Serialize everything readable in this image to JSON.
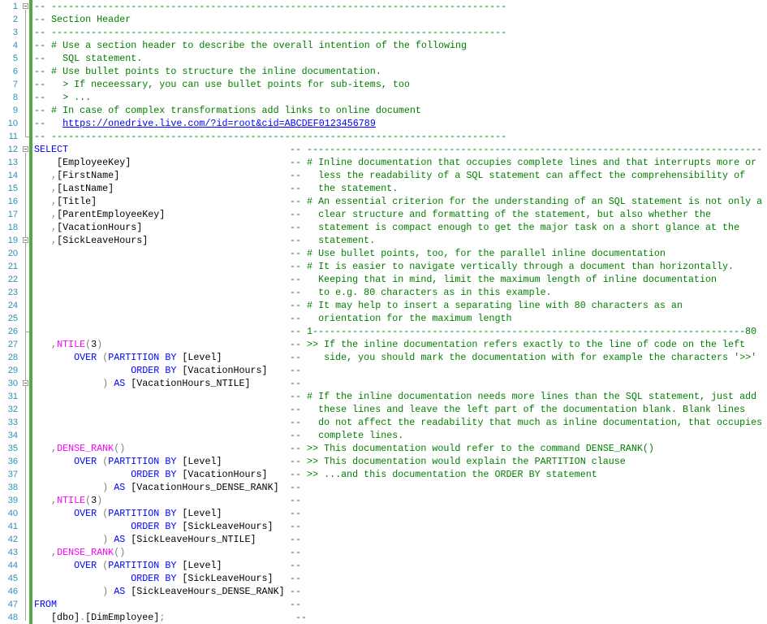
{
  "editor": {
    "colors": {
      "keyword": "#0000ff",
      "function": "#ff00ff",
      "punctuation": "#808080",
      "comment": "#008000",
      "line_number": "#2b91af",
      "change_bar": "#57a64a"
    },
    "lines": [
      {
        "num": "1",
        "code": [
          [
            "c",
            "-- --------------------------------------------------------------------------------"
          ]
        ],
        "comment": ""
      },
      {
        "num": "2",
        "code": [
          [
            "c",
            "-- Section Header"
          ]
        ],
        "comment": ""
      },
      {
        "num": "3",
        "code": [
          [
            "c",
            "-- --------------------------------------------------------------------------------"
          ]
        ],
        "comment": ""
      },
      {
        "num": "4",
        "code": [
          [
            "c",
            "-- # Use a section header to describe the overall intention of the following"
          ]
        ],
        "comment": ""
      },
      {
        "num": "5",
        "code": [
          [
            "c",
            "--   SQL statement."
          ]
        ],
        "comment": ""
      },
      {
        "num": "6",
        "code": [
          [
            "c",
            "-- # Use bullet points to structure the inline documentation."
          ]
        ],
        "comment": ""
      },
      {
        "num": "7",
        "code": [
          [
            "c",
            "--   > If neceessary, you can use bullet points for sub-items, too"
          ]
        ],
        "comment": ""
      },
      {
        "num": "8",
        "code": [
          [
            "c",
            "--   > ..."
          ]
        ],
        "comment": ""
      },
      {
        "num": "9",
        "code": [
          [
            "c",
            "-- # In case of complex transformations add links to online document"
          ]
        ],
        "comment": ""
      },
      {
        "num": "10",
        "code": [
          [
            "c",
            "--   "
          ],
          [
            "u",
            "https://onedrive.live.com/?id=root&cid=ABCDEF0123456789"
          ]
        ],
        "comment": ""
      },
      {
        "num": "11",
        "code": [
          [
            "c",
            "-- --------------------------------------------------------------------------------"
          ]
        ],
        "comment": ""
      },
      {
        "num": "12",
        "code": [
          [
            "k",
            "SELECT"
          ]
        ],
        "comment": "-- --------------------------------------------------------------------------------"
      },
      {
        "num": "13",
        "code": [
          [
            "n",
            "    [EmployeeKey]"
          ]
        ],
        "comment": "-- # Inline documentation that occupies complete lines and that interrupts more or"
      },
      {
        "num": "14",
        "code": [
          [
            "n",
            "   "
          ],
          [
            "p",
            ","
          ],
          [
            "n",
            "[FirstName]"
          ]
        ],
        "comment": "--   less the readability of a SQL statement can affect the comprehensibility of"
      },
      {
        "num": "15",
        "code": [
          [
            "n",
            "   "
          ],
          [
            "p",
            ","
          ],
          [
            "n",
            "[LastName]"
          ]
        ],
        "comment": "--   the statement."
      },
      {
        "num": "16",
        "code": [
          [
            "n",
            "   "
          ],
          [
            "p",
            ","
          ],
          [
            "n",
            "[Title]"
          ]
        ],
        "comment": "-- # An essential criterion for the understanding of an SQL statement is not only a"
      },
      {
        "num": "17",
        "code": [
          [
            "n",
            "   "
          ],
          [
            "p",
            ","
          ],
          [
            "n",
            "[ParentEmployeeKey]"
          ]
        ],
        "comment": "--   clear structure and formatting of the statement, but also whether the"
      },
      {
        "num": "18",
        "code": [
          [
            "n",
            "   "
          ],
          [
            "p",
            ","
          ],
          [
            "n",
            "[VacationHours]"
          ]
        ],
        "comment": "--   statement is compact enough to get the major task on a short glance at the"
      },
      {
        "num": "19",
        "code": [
          [
            "n",
            "   "
          ],
          [
            "p",
            ","
          ],
          [
            "n",
            "[SickLeaveHours]"
          ]
        ],
        "comment": "--   statement."
      },
      {
        "num": "20",
        "code": [],
        "comment": "-- # Use bullet points, too, for the parallel inline documentation"
      },
      {
        "num": "21",
        "code": [],
        "comment": "-- # It is easier to navigate vertically through a document than horizontally."
      },
      {
        "num": "22",
        "code": [],
        "comment": "--   Keeping that in mind, limit the maximum length of inline documentation"
      },
      {
        "num": "23",
        "code": [],
        "comment": "--   to e.g. 80 characters as in this example."
      },
      {
        "num": "24",
        "code": [],
        "comment": "-- # It may help to insert a separating line with 80 characters as an"
      },
      {
        "num": "25",
        "code": [],
        "comment": "--   orientation for the maximum length"
      },
      {
        "num": "26",
        "code": [],
        "comment": "-- 1----------------------------------------------------------------------------80"
      },
      {
        "num": "27",
        "code": [
          [
            "n",
            "   "
          ],
          [
            "p",
            ","
          ],
          [
            "f",
            "NTILE"
          ],
          [
            "p",
            "("
          ],
          [
            "n",
            "3"
          ],
          [
            "p",
            ")"
          ]
        ],
        "comment": "-- >> If the inline documentation refers exactly to the line of code on the left"
      },
      {
        "num": "28",
        "code": [
          [
            "n",
            "       "
          ],
          [
            "k",
            "OVER"
          ],
          [
            "n",
            " "
          ],
          [
            "p",
            "("
          ],
          [
            "k",
            "PARTITION BY"
          ],
          [
            "n",
            " [Level]"
          ]
        ],
        "comment": "--    side, you should mark the documentation with for example the characters '>>'"
      },
      {
        "num": "29",
        "code": [
          [
            "n",
            "                 "
          ],
          [
            "k",
            "ORDER BY"
          ],
          [
            "n",
            " [VacationHours]"
          ]
        ],
        "comment": "--"
      },
      {
        "num": "30",
        "code": [
          [
            "n",
            "            "
          ],
          [
            "p",
            ")"
          ],
          [
            "n",
            " "
          ],
          [
            "k",
            "AS"
          ],
          [
            "n",
            " [VacationHours_NTILE]"
          ]
        ],
        "comment": "--"
      },
      {
        "num": "31",
        "code": [],
        "comment": "-- # If the inline documentation needs more lines than the SQL statement, just add"
      },
      {
        "num": "32",
        "code": [],
        "comment": "--   these lines and leave the left part of the documentation blank. Blank lines"
      },
      {
        "num": "33",
        "code": [],
        "comment": "--   do not affect the readability that much as inline documentation, that occupies"
      },
      {
        "num": "34",
        "code": [],
        "comment": "--   complete lines."
      },
      {
        "num": "35",
        "code": [
          [
            "n",
            "   "
          ],
          [
            "p",
            ","
          ],
          [
            "f",
            "DENSE_RANK"
          ],
          [
            "p",
            "()"
          ]
        ],
        "comment": "-- >> This documentation would refer to the command DENSE_RANK()"
      },
      {
        "num": "36",
        "code": [
          [
            "n",
            "       "
          ],
          [
            "k",
            "OVER"
          ],
          [
            "n",
            " "
          ],
          [
            "p",
            "("
          ],
          [
            "k",
            "PARTITION BY"
          ],
          [
            "n",
            " [Level]"
          ]
        ],
        "comment": "-- >> This documentation would explain the PARTITION clause"
      },
      {
        "num": "37",
        "code": [
          [
            "n",
            "                 "
          ],
          [
            "k",
            "ORDER BY"
          ],
          [
            "n",
            " [VacationHours]"
          ]
        ],
        "comment": "-- >> ...and this documentation the ORDER BY statement"
      },
      {
        "num": "38",
        "code": [
          [
            "n",
            "            "
          ],
          [
            "p",
            ")"
          ],
          [
            "n",
            " "
          ],
          [
            "k",
            "AS"
          ],
          [
            "n",
            " [VacationHours_DENSE_RANK]"
          ]
        ],
        "comment": "--"
      },
      {
        "num": "39",
        "code": [
          [
            "n",
            "   "
          ],
          [
            "p",
            ","
          ],
          [
            "f",
            "NTILE"
          ],
          [
            "p",
            "("
          ],
          [
            "n",
            "3"
          ],
          [
            "p",
            ")"
          ]
        ],
        "comment": "--"
      },
      {
        "num": "40",
        "code": [
          [
            "n",
            "       "
          ],
          [
            "k",
            "OVER"
          ],
          [
            "n",
            " "
          ],
          [
            "p",
            "("
          ],
          [
            "k",
            "PARTITION BY"
          ],
          [
            "n",
            " [Level]"
          ]
        ],
        "comment": "--"
      },
      {
        "num": "41",
        "code": [
          [
            "n",
            "                 "
          ],
          [
            "k",
            "ORDER BY"
          ],
          [
            "n",
            " [SickLeaveHours]"
          ]
        ],
        "comment": "--"
      },
      {
        "num": "42",
        "code": [
          [
            "n",
            "            "
          ],
          [
            "p",
            ")"
          ],
          [
            "n",
            " "
          ],
          [
            "k",
            "AS"
          ],
          [
            "n",
            " [SickLeaveHours_NTILE]"
          ]
        ],
        "comment": "--"
      },
      {
        "num": "43",
        "code": [
          [
            "n",
            "   "
          ],
          [
            "p",
            ","
          ],
          [
            "f",
            "DENSE_RANK"
          ],
          [
            "p",
            "()"
          ]
        ],
        "comment": "--"
      },
      {
        "num": "44",
        "code": [
          [
            "n",
            "       "
          ],
          [
            "k",
            "OVER"
          ],
          [
            "n",
            " "
          ],
          [
            "p",
            "("
          ],
          [
            "k",
            "PARTITION BY"
          ],
          [
            "n",
            " [Level]"
          ]
        ],
        "comment": "--"
      },
      {
        "num": "45",
        "code": [
          [
            "n",
            "                 "
          ],
          [
            "k",
            "ORDER BY"
          ],
          [
            "n",
            " [SickLeaveHours]"
          ]
        ],
        "comment": "--"
      },
      {
        "num": "46",
        "code": [
          [
            "n",
            "            "
          ],
          [
            "p",
            ")"
          ],
          [
            "n",
            " "
          ],
          [
            "k",
            "AS"
          ],
          [
            "n",
            " [SickLeaveHours_DENSE_RANK]"
          ]
        ],
        "comment": "--"
      },
      {
        "num": "47",
        "code": [
          [
            "k",
            "FROM"
          ]
        ],
        "comment": "--"
      },
      {
        "num": "48",
        "code": [
          [
            "n",
            "   [dbo]"
          ],
          [
            "p",
            "."
          ],
          [
            "n",
            "[DimEmployee]"
          ],
          [
            "p",
            ";"
          ]
        ],
        "comment": " --"
      }
    ]
  }
}
